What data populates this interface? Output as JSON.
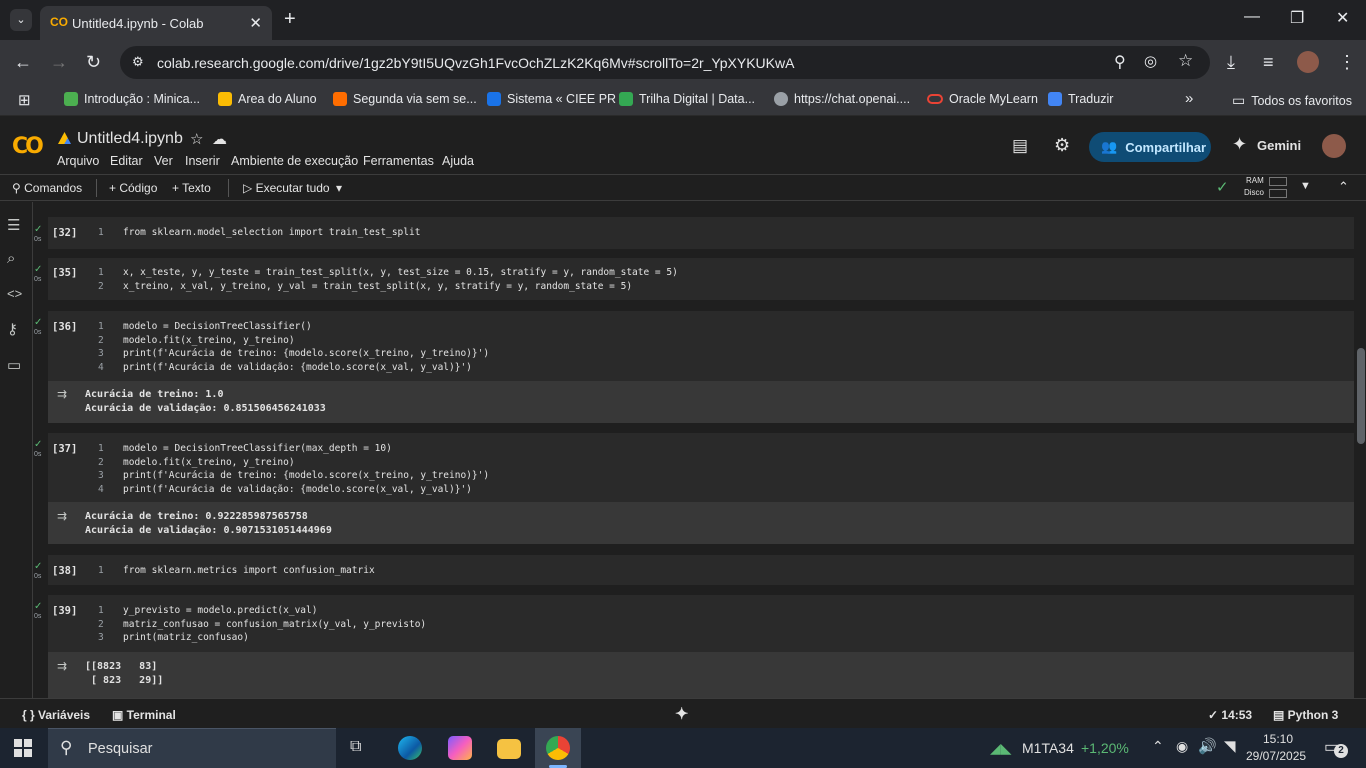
{
  "browser": {
    "tab_title": "Untitled4.ipynb - Colab",
    "url": "colab.research.google.com/drive/1gz2bY9tI5UQvzGh1FvcOchZLzK2Kq6Mv#scrollTo=2r_YpXYKUKwA",
    "bookmarks": [
      {
        "label": "Introdução : Minica...",
        "color": "#4caf50"
      },
      {
        "label": "Area do Aluno",
        "color": "#fbbc04"
      },
      {
        "label": "Segunda via sem se...",
        "color": "#ff6d00"
      },
      {
        "label": "Sistema « CIEE PR",
        "color": "#1a73e8"
      },
      {
        "label": "Trilha Digital | Data...",
        "color": "#34a853"
      },
      {
        "label": "https://chat.openai....",
        "color": "#9aa0a6"
      },
      {
        "label": "Oracle MyLearn",
        "color": "#ea4335"
      },
      {
        "label": "Traduzir",
        "color": "#4285f4"
      }
    ],
    "all_bookmarks": "Todos os favoritos"
  },
  "colab": {
    "filename": "Untitled4.ipynb",
    "menu": [
      "Arquivo",
      "Editar",
      "Ver",
      "Inserir",
      "Ambiente de execução",
      "Ferramentas",
      "Ajuda"
    ],
    "share_label": "Compartilhar",
    "gemini_label": "Gemini",
    "toolbar": {
      "commands": "Comandos",
      "add_code": "+ Código",
      "add_text": "+ Texto",
      "run_all": "Executar tudo",
      "ram": "RAM",
      "disk": "Disco"
    }
  },
  "cells": [
    {
      "num": "[32]",
      "time": "0s",
      "lines": [
        "from sklearn.model_selection import train_test_split"
      ]
    },
    {
      "num": "[35]",
      "time": "0s",
      "lines": [
        "x, x_teste, y, y_teste = train_test_split(x, y, test_size = 0.15, stratify = y, random_state = 5)",
        "x_treino, x_val, y_treino, y_val = train_test_split(x, y, stratify = y, random_state = 5)"
      ]
    },
    {
      "num": "[36]",
      "time": "0s",
      "lines": [
        "modelo = DecisionTreeClassifier()",
        "modelo.fit(x_treino, y_treino)",
        "print(f'Acurácia de treino: {modelo.score(x_treino, y_treino)}')",
        "print(f'Acurácia de validação: {modelo.score(x_val, y_val)}')"
      ],
      "output": [
        "Acurácia de treino: 1.0",
        "Acurácia de validação: 0.851506456241033"
      ]
    },
    {
      "num": "[37]",
      "time": "0s",
      "lines": [
        "modelo = DecisionTreeClassifier(max_depth = 10)",
        "modelo.fit(x_treino, y_treino)",
        "print(f'Acurácia de treino: {modelo.score(x_treino, y_treino)}')",
        "print(f'Acurácia de validação: {modelo.score(x_val, y_val)}')"
      ],
      "output": [
        "Acurácia de treino: 0.922285987565758",
        "Acurácia de validação: 0.9071531051444969"
      ]
    },
    {
      "num": "[38]",
      "time": "0s",
      "lines": [
        "from sklearn.metrics import confusion_matrix"
      ]
    },
    {
      "num": "[39]",
      "time": "0s",
      "lines": [
        "y_previsto = modelo.predict(x_val)",
        "matriz_confusao = confusion_matrix(y_val, y_previsto)",
        "print(matriz_confusao)"
      ],
      "output": [
        "[[8823   83]",
        " [ 823   29]]"
      ]
    }
  ],
  "statusbar": {
    "variables": "Variáveis",
    "terminal": "Terminal",
    "time": "14:53",
    "runtime": "Python 3"
  },
  "taskbar": {
    "search_placeholder": "Pesquisar",
    "stock_name": "M1TA34",
    "stock_change": "+1,20%",
    "clock_time": "15:10",
    "clock_date": "29/07/2025",
    "notifications": "2"
  }
}
